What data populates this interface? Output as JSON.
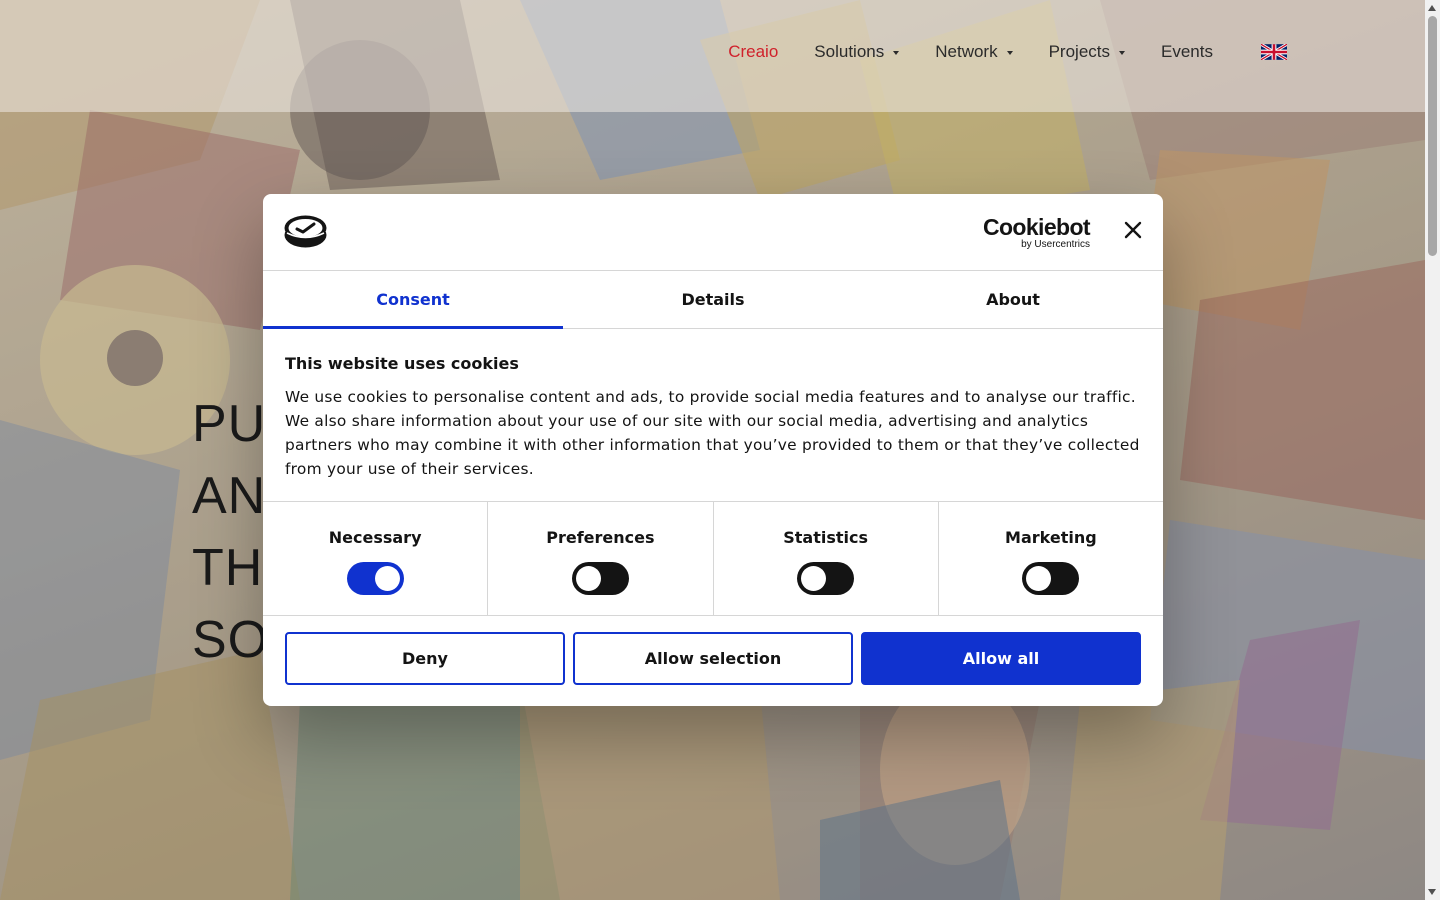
{
  "nav": {
    "items": [
      {
        "label": "Creaio",
        "active": true,
        "has_caret": false
      },
      {
        "label": "Solutions",
        "active": false,
        "has_caret": true
      },
      {
        "label": "Network",
        "active": false,
        "has_caret": true
      },
      {
        "label": "Projects",
        "active": false,
        "has_caret": true
      },
      {
        "label": "Events",
        "active": false,
        "has_caret": false
      }
    ],
    "language_icon": "uk-flag-icon",
    "active_color": "#d0212b"
  },
  "hero": {
    "lines": [
      "PUT",
      "AN",
      "THI",
      "SO"
    ]
  },
  "cookie_dialog": {
    "brand": {
      "name": "Cookiebot",
      "sub": "by Usercentrics"
    },
    "tabs": [
      {
        "label": "Consent",
        "active": true
      },
      {
        "label": "Details",
        "active": false
      },
      {
        "label": "About",
        "active": false
      }
    ],
    "title": "This website uses cookies",
    "text": "We use cookies to personalise content and ads, to provide social media features and to analyse our traffic. We also share information about your use of our site with our social media, advertising and analytics partners who may combine it with other information that you’ve provided to them or that they’ve collected from your use of their services.",
    "toggles": [
      {
        "label": "Necessary",
        "on": true
      },
      {
        "label": "Preferences",
        "on": false
      },
      {
        "label": "Statistics",
        "on": false
      },
      {
        "label": "Marketing",
        "on": false
      }
    ],
    "buttons": {
      "deny": "Deny",
      "allow_selection": "Allow selection",
      "allow_all": "Allow all"
    },
    "accent_color": "#1032cf"
  }
}
